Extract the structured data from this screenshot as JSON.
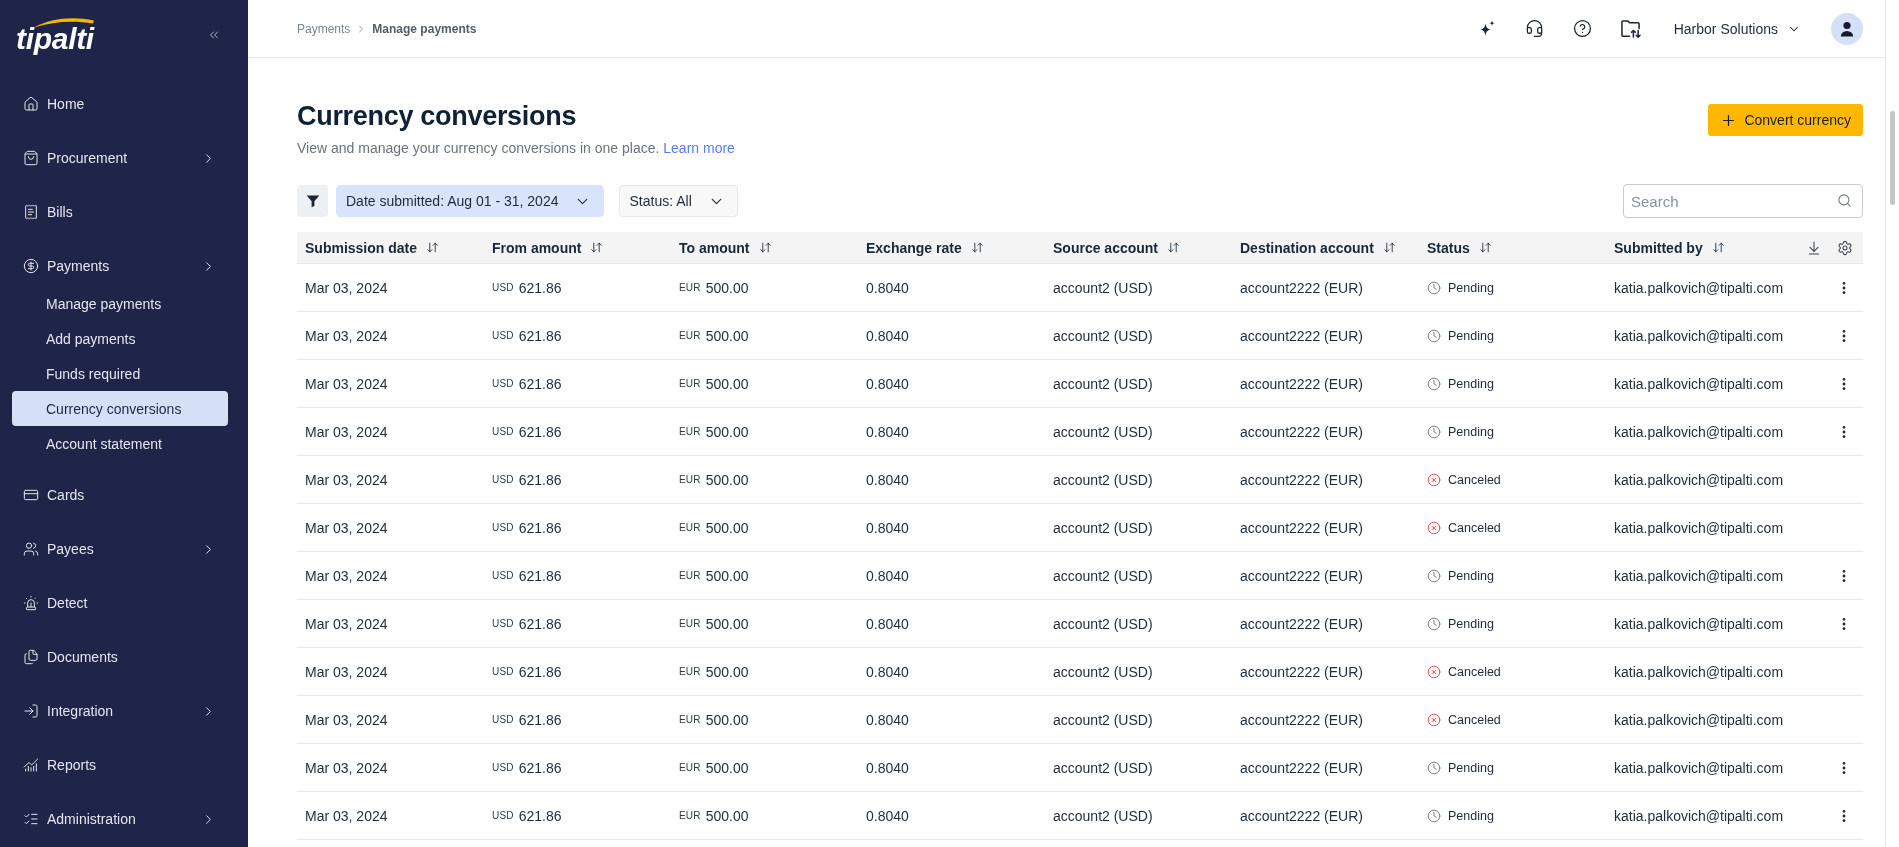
{
  "sidebar": {
    "logo": "tipalti",
    "items": [
      {
        "label": "Home",
        "selected": false,
        "has_submenu": false
      },
      {
        "label": "Procurement",
        "selected": false,
        "has_submenu": true
      },
      {
        "label": "Bills",
        "selected": false,
        "has_submenu": false
      },
      {
        "label": "Payments",
        "selected": false,
        "has_submenu": true,
        "children": [
          {
            "label": "Manage payments",
            "selected": false
          },
          {
            "label": "Add payments",
            "selected": false
          },
          {
            "label": "Funds required",
            "selected": false
          },
          {
            "label": "Currency conversions",
            "selected": true
          },
          {
            "label": "Account statement",
            "selected": false
          }
        ]
      },
      {
        "label": "Cards",
        "selected": false,
        "has_submenu": false
      },
      {
        "label": "Payees",
        "selected": false,
        "has_submenu": true
      },
      {
        "label": "Detect",
        "selected": false,
        "has_submenu": false
      },
      {
        "label": "Documents",
        "selected": false,
        "has_submenu": false
      },
      {
        "label": "Integration",
        "selected": false,
        "has_submenu": true
      },
      {
        "label": "Reports",
        "selected": false,
        "has_submenu": false
      },
      {
        "label": "Administration",
        "selected": false,
        "has_submenu": true
      }
    ]
  },
  "header": {
    "breadcrumb": [
      "Payments",
      "Manage payments"
    ],
    "company": "Harbor Solutions"
  },
  "page": {
    "title": "Currency conversions",
    "subtitle": "View and manage your currency conversions in one place.",
    "link": "Learn more",
    "convert_button": "Convert currency"
  },
  "filters": [
    {
      "label": "Date submitted: Aug 01 - 31, 2024",
      "active": true
    },
    {
      "label": "Status: All",
      "active": false
    }
  ],
  "search": {
    "placeholder": "Search"
  },
  "table": {
    "columns": [
      "Submission date",
      "From amount",
      "To amount",
      "Exchange rate",
      "Source account",
      "Destination account",
      "Status",
      "Submitted by"
    ],
    "rows": [
      {
        "submission_date": "Mar 03, 2024",
        "from_amount": {
          "currency": "USD",
          "amount": "621.86"
        },
        "to_amount": {
          "currency": "EUR",
          "amount": "500.00"
        },
        "exchange_rate": "0.8040",
        "source_account": "account2 (USD)",
        "destination_account": "account2222 (EUR)",
        "status": {
          "kind": "pending",
          "label": "Pending"
        },
        "submitted_by": "katia.palkovich@tipalti.com",
        "actions_menu": true
      },
      {
        "submission_date": "Mar 03, 2024",
        "from_amount": {
          "currency": "USD",
          "amount": "621.86"
        },
        "to_amount": {
          "currency": "EUR",
          "amount": "500.00"
        },
        "exchange_rate": "0.8040",
        "source_account": "account2 (USD)",
        "destination_account": "account2222 (EUR)",
        "status": {
          "kind": "pending",
          "label": "Pending"
        },
        "submitted_by": "katia.palkovich@tipalti.com",
        "actions_menu": true
      },
      {
        "submission_date": "Mar 03, 2024",
        "from_amount": {
          "currency": "USD",
          "amount": "621.86"
        },
        "to_amount": {
          "currency": "EUR",
          "amount": "500.00"
        },
        "exchange_rate": "0.8040",
        "source_account": "account2 (USD)",
        "destination_account": "account2222 (EUR)",
        "status": {
          "kind": "pending",
          "label": "Pending"
        },
        "submitted_by": "katia.palkovich@tipalti.com",
        "actions_menu": true
      },
      {
        "submission_date": "Mar 03, 2024",
        "from_amount": {
          "currency": "USD",
          "amount": "621.86"
        },
        "to_amount": {
          "currency": "EUR",
          "amount": "500.00"
        },
        "exchange_rate": "0.8040",
        "source_account": "account2 (USD)",
        "destination_account": "account2222 (EUR)",
        "status": {
          "kind": "pending",
          "label": "Pending"
        },
        "submitted_by": "katia.palkovich@tipalti.com",
        "actions_menu": true
      },
      {
        "submission_date": "Mar 03, 2024",
        "from_amount": {
          "currency": "USD",
          "amount": "621.86"
        },
        "to_amount": {
          "currency": "EUR",
          "amount": "500.00"
        },
        "exchange_rate": "0.8040",
        "source_account": "account2 (USD)",
        "destination_account": "account2222 (EUR)",
        "status": {
          "kind": "canceled",
          "label": "Canceled"
        },
        "submitted_by": "katia.palkovich@tipalti.com",
        "actions_menu": false
      },
      {
        "submission_date": "Mar 03, 2024",
        "from_amount": {
          "currency": "USD",
          "amount": "621.86"
        },
        "to_amount": {
          "currency": "EUR",
          "amount": "500.00"
        },
        "exchange_rate": "0.8040",
        "source_account": "account2 (USD)",
        "destination_account": "account2222 (EUR)",
        "status": {
          "kind": "canceled",
          "label": "Canceled"
        },
        "submitted_by": "katia.palkovich@tipalti.com",
        "actions_menu": false
      },
      {
        "submission_date": "Mar 03, 2024",
        "from_amount": {
          "currency": "USD",
          "amount": "621.86"
        },
        "to_amount": {
          "currency": "EUR",
          "amount": "500.00"
        },
        "exchange_rate": "0.8040",
        "source_account": "account2 (USD)",
        "destination_account": "account2222 (EUR)",
        "status": {
          "kind": "pending",
          "label": "Pending"
        },
        "submitted_by": "katia.palkovich@tipalti.com",
        "actions_menu": true
      },
      {
        "submission_date": "Mar 03, 2024",
        "from_amount": {
          "currency": "USD",
          "amount": "621.86"
        },
        "to_amount": {
          "currency": "EUR",
          "amount": "500.00"
        },
        "exchange_rate": "0.8040",
        "source_account": "account2 (USD)",
        "destination_account": "account2222 (EUR)",
        "status": {
          "kind": "pending",
          "label": "Pending"
        },
        "submitted_by": "katia.palkovich@tipalti.com",
        "actions_menu": true
      },
      {
        "submission_date": "Mar 03, 2024",
        "from_amount": {
          "currency": "USD",
          "amount": "621.86"
        },
        "to_amount": {
          "currency": "EUR",
          "amount": "500.00"
        },
        "exchange_rate": "0.8040",
        "source_account": "account2 (USD)",
        "destination_account": "account2222 (EUR)",
        "status": {
          "kind": "canceled",
          "label": "Canceled"
        },
        "submitted_by": "katia.palkovich@tipalti.com",
        "actions_menu": false
      },
      {
        "submission_date": "Mar 03, 2024",
        "from_amount": {
          "currency": "USD",
          "amount": "621.86"
        },
        "to_amount": {
          "currency": "EUR",
          "amount": "500.00"
        },
        "exchange_rate": "0.8040",
        "source_account": "account2 (USD)",
        "destination_account": "account2222 (EUR)",
        "status": {
          "kind": "canceled",
          "label": "Canceled"
        },
        "submitted_by": "katia.palkovich@tipalti.com",
        "actions_menu": false
      },
      {
        "submission_date": "Mar 03, 2024",
        "from_amount": {
          "currency": "USD",
          "amount": "621.86"
        },
        "to_amount": {
          "currency": "EUR",
          "amount": "500.00"
        },
        "exchange_rate": "0.8040",
        "source_account": "account2 (USD)",
        "destination_account": "account2222 (EUR)",
        "status": {
          "kind": "pending",
          "label": "Pending"
        },
        "submitted_by": "katia.palkovich@tipalti.com",
        "actions_menu": true
      },
      {
        "submission_date": "Mar 03, 2024",
        "from_amount": {
          "currency": "USD",
          "amount": "621.86"
        },
        "to_amount": {
          "currency": "EUR",
          "amount": "500.00"
        },
        "exchange_rate": "0.8040",
        "source_account": "account2 (USD)",
        "destination_account": "account2222 (EUR)",
        "status": {
          "kind": "pending",
          "label": "Pending"
        },
        "submitted_by": "katia.palkovich@tipalti.com",
        "actions_menu": true
      }
    ]
  }
}
